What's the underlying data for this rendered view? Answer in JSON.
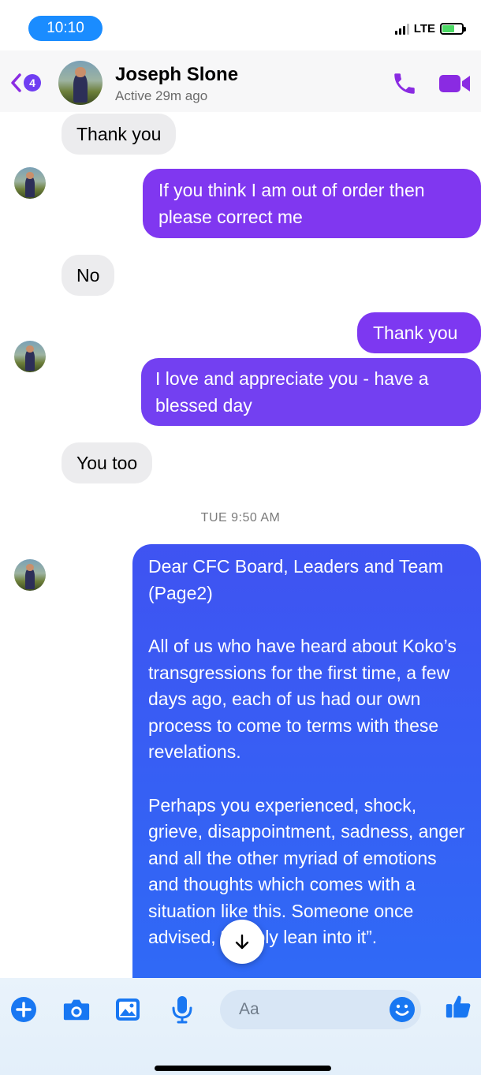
{
  "status_bar": {
    "time": "10:10",
    "network": "LTE"
  },
  "header": {
    "back_count": "4",
    "contact_name": "Joseph Slone",
    "active_status": "Active 29m ago",
    "call_icon": "phone-icon",
    "video_icon": "video-camera-icon"
  },
  "messages": [
    {
      "direction": "incoming",
      "text": "Thank you"
    },
    {
      "direction": "outgoing",
      "text": "If you think I am out of order then please correct me"
    },
    {
      "direction": "incoming",
      "text": "No"
    },
    {
      "direction": "outgoing",
      "text": "Thank you"
    },
    {
      "direction": "outgoing",
      "text": "I love and appreciate you - have a blessed day"
    },
    {
      "direction": "incoming",
      "text": "You too"
    }
  ],
  "timestamp": "TUE 9:50 AM",
  "long_message": {
    "paragraphs": [
      "Dear CFC Board, Leaders and Team (Page2)",
      "All of us who have heard about Koko’s transgressions for the first time,  a few days ago, each of us had our own process to come to terms with these revelations.",
      "Perhaps you experienced, shock, grieve, disappointment, sadness, anger and all the other myriad of emotions and thoughts which comes with a situation like this. Someone once advised, “simply lean into it”."
    ]
  },
  "composer": {
    "placeholder": "Aa",
    "icons": [
      "plus-icon",
      "camera-icon",
      "image-icon",
      "microphone-icon",
      "emoji-icon",
      "thumbs-up-icon"
    ]
  },
  "colors": {
    "accent": "#8a2be2",
    "outgoing_bubble": "#7b3bf0",
    "outgoing_bubble_blue": "#2f6af6",
    "time_pill": "#1a8cff",
    "composer_icon": "#1877f2"
  }
}
